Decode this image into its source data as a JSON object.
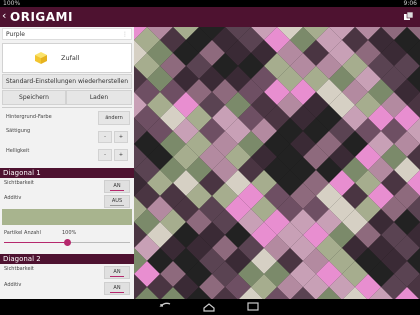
{
  "statusbar": {
    "left": "100%",
    "right": "9:06"
  },
  "actionbar": {
    "back": "‹",
    "title": "ORIGAMI",
    "share_icon": "origami-shape-icon"
  },
  "panel": {
    "palette_value": "Purple",
    "random_label": "Zufall",
    "reset_label": "Standard-Einstellungen wiederherstellen",
    "save_label": "Speichern",
    "load_label": "Laden",
    "background_color_label": "Hintergrund-Farbe",
    "change_label": "ändern",
    "saturation_label": "Sättigung",
    "brightness_label": "Helligkeit",
    "minus": "-",
    "plus": "+",
    "diagonal1": {
      "title": "Diagonal 1",
      "visibility_label": "Sichtbarkeit",
      "visibility_value": "AN",
      "additive_label": "Additiv",
      "additive_value": "AUS",
      "color_strip": "#a8b48e",
      "particle_count_label": "Partikel Anzahl",
      "particle_count_value": "100%",
      "particle_count_fraction": 0.5
    },
    "diagonal2": {
      "title": "Diagonal 2",
      "visibility_label": "Sichtbarkeit",
      "visibility_value": "AN",
      "additive_label": "Additiv",
      "additive_value": "AN"
    }
  },
  "colors": {
    "accent": "#4e1230",
    "highlight": "#b5286d"
  }
}
